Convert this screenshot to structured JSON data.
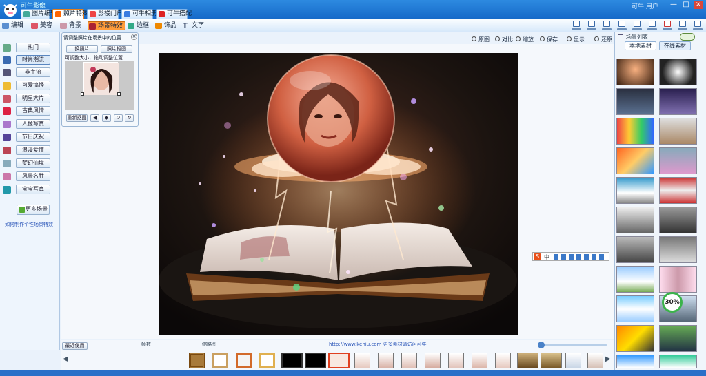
{
  "window": {
    "title": "可牛影像",
    "user": "可牛 用户",
    "controls": [
      "—",
      "□",
      "×"
    ]
  },
  "colors": {
    "titlebar": "#1e78d8",
    "accent": "#ff7a00",
    "panel": "#eef5fd"
  },
  "main_tabs": [
    {
      "label": "图片编辑",
      "icon": "picture-edit-icon",
      "active": false
    },
    {
      "label": "照片特效",
      "icon": "photo-effects-icon",
      "active": true
    },
    {
      "label": "影楼门户",
      "icon": "studio-icon",
      "active": false
    },
    {
      "label": "可牛相册",
      "icon": "album-icon",
      "active": false
    },
    {
      "label": "可牛搭配",
      "icon": "collage-icon",
      "active": false
    }
  ],
  "toolbar": {
    "items": [
      {
        "label": "编辑",
        "icon": "edit-icon"
      },
      {
        "label": "美容",
        "icon": "beauty-icon"
      },
      {
        "label": "背景",
        "icon": "background-icon"
      },
      {
        "label": "场景特效",
        "icon": "scene-icon",
        "active": true
      },
      {
        "label": "边框",
        "icon": "frame-icon"
      },
      {
        "label": "饰品",
        "icon": "accessory-icon"
      },
      {
        "label": "文字",
        "icon": "text-icon"
      }
    ],
    "right_icons": [
      "open-icon",
      "save-icon",
      "print-icon",
      "share-icon",
      "upload-icon",
      "batch-icon",
      "undo-icon",
      "redo-icon",
      "compare-icon",
      "settings-icon"
    ]
  },
  "sidebar": {
    "items": [
      "热门",
      "时尚潮流",
      "非主流",
      "可爱搞怪",
      "明星大片",
      "古典风情",
      "人像写真",
      "节日庆祝",
      "浪漫爱情",
      "梦幻仙境",
      "风景名胜",
      "宝宝写真"
    ],
    "download_button": "更多场景",
    "link": "如何制作个性场景特效"
  },
  "edit_panel": {
    "title": "请调整照片在场景中的位置",
    "buttons": [
      "换照片",
      "照片抠图"
    ],
    "hint": "可调整大小，拖动调整位置",
    "controls": [
      "重新抠图",
      "左移",
      "右移",
      "左转",
      "右转"
    ]
  },
  "canvas_controls": [
    "原图",
    "对比",
    "缩放",
    "保存",
    "显示",
    "还原"
  ],
  "right_panel": {
    "header": "场景列表",
    "tabs": [
      "本地素材",
      "在线素材"
    ]
  },
  "filmstrip": {
    "label": "最近使用",
    "info1": "帧数",
    "info2": "缩略图",
    "link": "http://www.keniu.com 更多素材请访问可牛"
  },
  "badge": {
    "text": "30%"
  }
}
